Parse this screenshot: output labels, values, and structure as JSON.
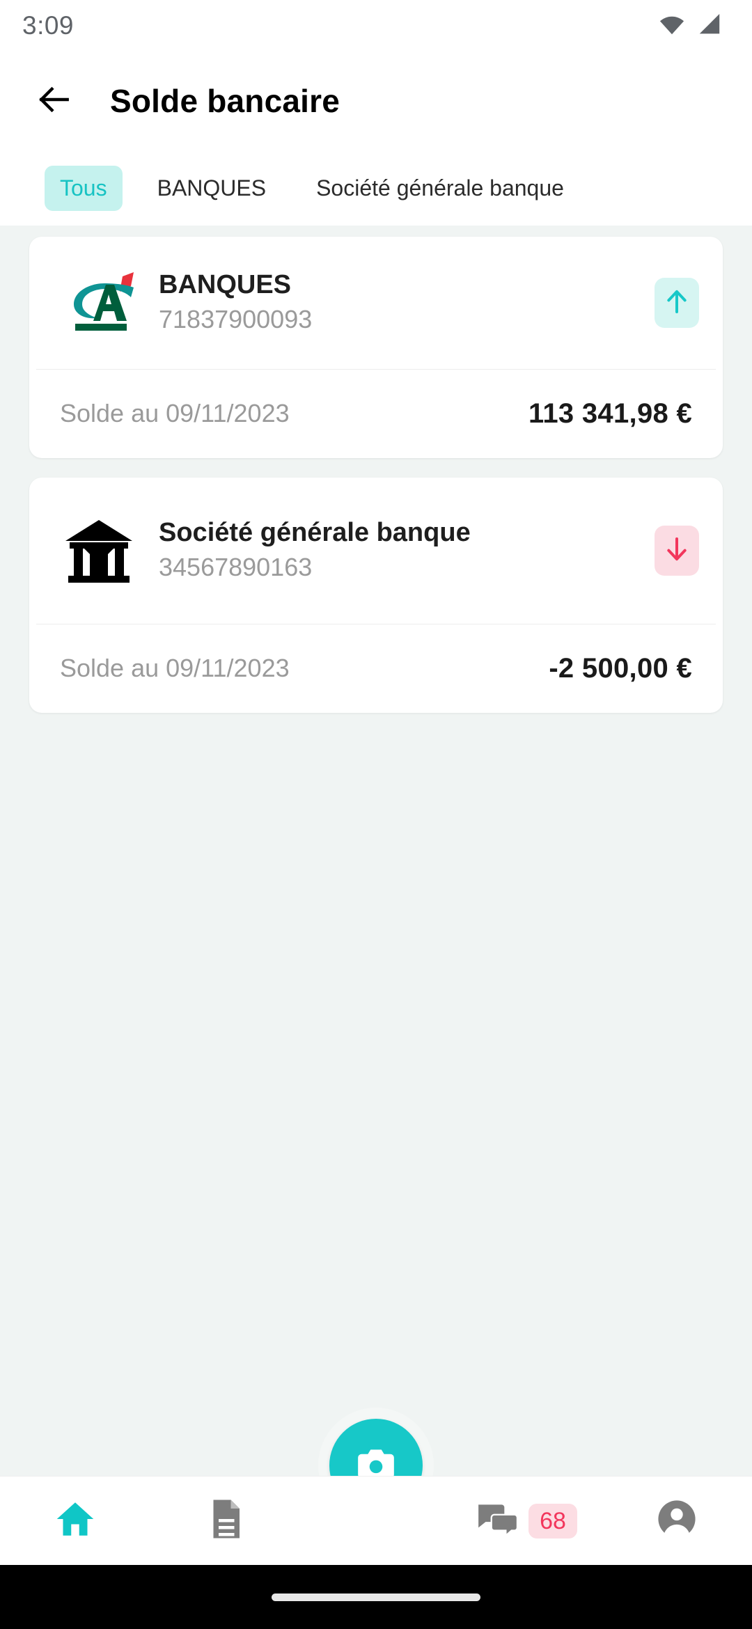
{
  "status_bar": {
    "time": "3:09",
    "icons": [
      "wifi-icon",
      "cellular-signal-icon"
    ]
  },
  "app_bar": {
    "back_icon": "arrow-left-icon",
    "title": "Solde bancaire"
  },
  "tabs": [
    {
      "label": "Tous",
      "active": true
    },
    {
      "label": "BANQUES",
      "active": false
    },
    {
      "label": "Société générale banque",
      "active": false
    }
  ],
  "accounts": [
    {
      "logo": "credit-agricole-logo",
      "name": "BANQUES",
      "number": "71837900093",
      "trend": "up",
      "trend_icon": "arrow-up-icon",
      "balance_label": "Solde au 09/11/2023",
      "balance_value": "113 341,98 €"
    },
    {
      "logo": "bank-building-icon",
      "name": "Société générale banque",
      "number": "34567890163",
      "trend": "down",
      "trend_icon": "arrow-down-icon",
      "balance_label": "Solde au 09/11/2023",
      "balance_value": "-2 500,00 €"
    }
  ],
  "bottom_nav": {
    "items": [
      {
        "icon": "home-icon",
        "active": true
      },
      {
        "icon": "document-icon",
        "active": false
      },
      {
        "icon": "chat-bubbles-icon",
        "active": false,
        "badge": "68"
      },
      {
        "icon": "person-icon",
        "active": false
      }
    ],
    "fab_icon": "camera-icon"
  },
  "colors": {
    "accent_teal": "#17C8C8",
    "tab_active_bg": "#C5F2EE",
    "up_badge_bg": "#D6F5F2",
    "down_badge_bg": "#FBDCE3",
    "down_arrow": "#F2365C",
    "badge_text": "#F2365C",
    "page_bg": "#F0F4F3"
  }
}
